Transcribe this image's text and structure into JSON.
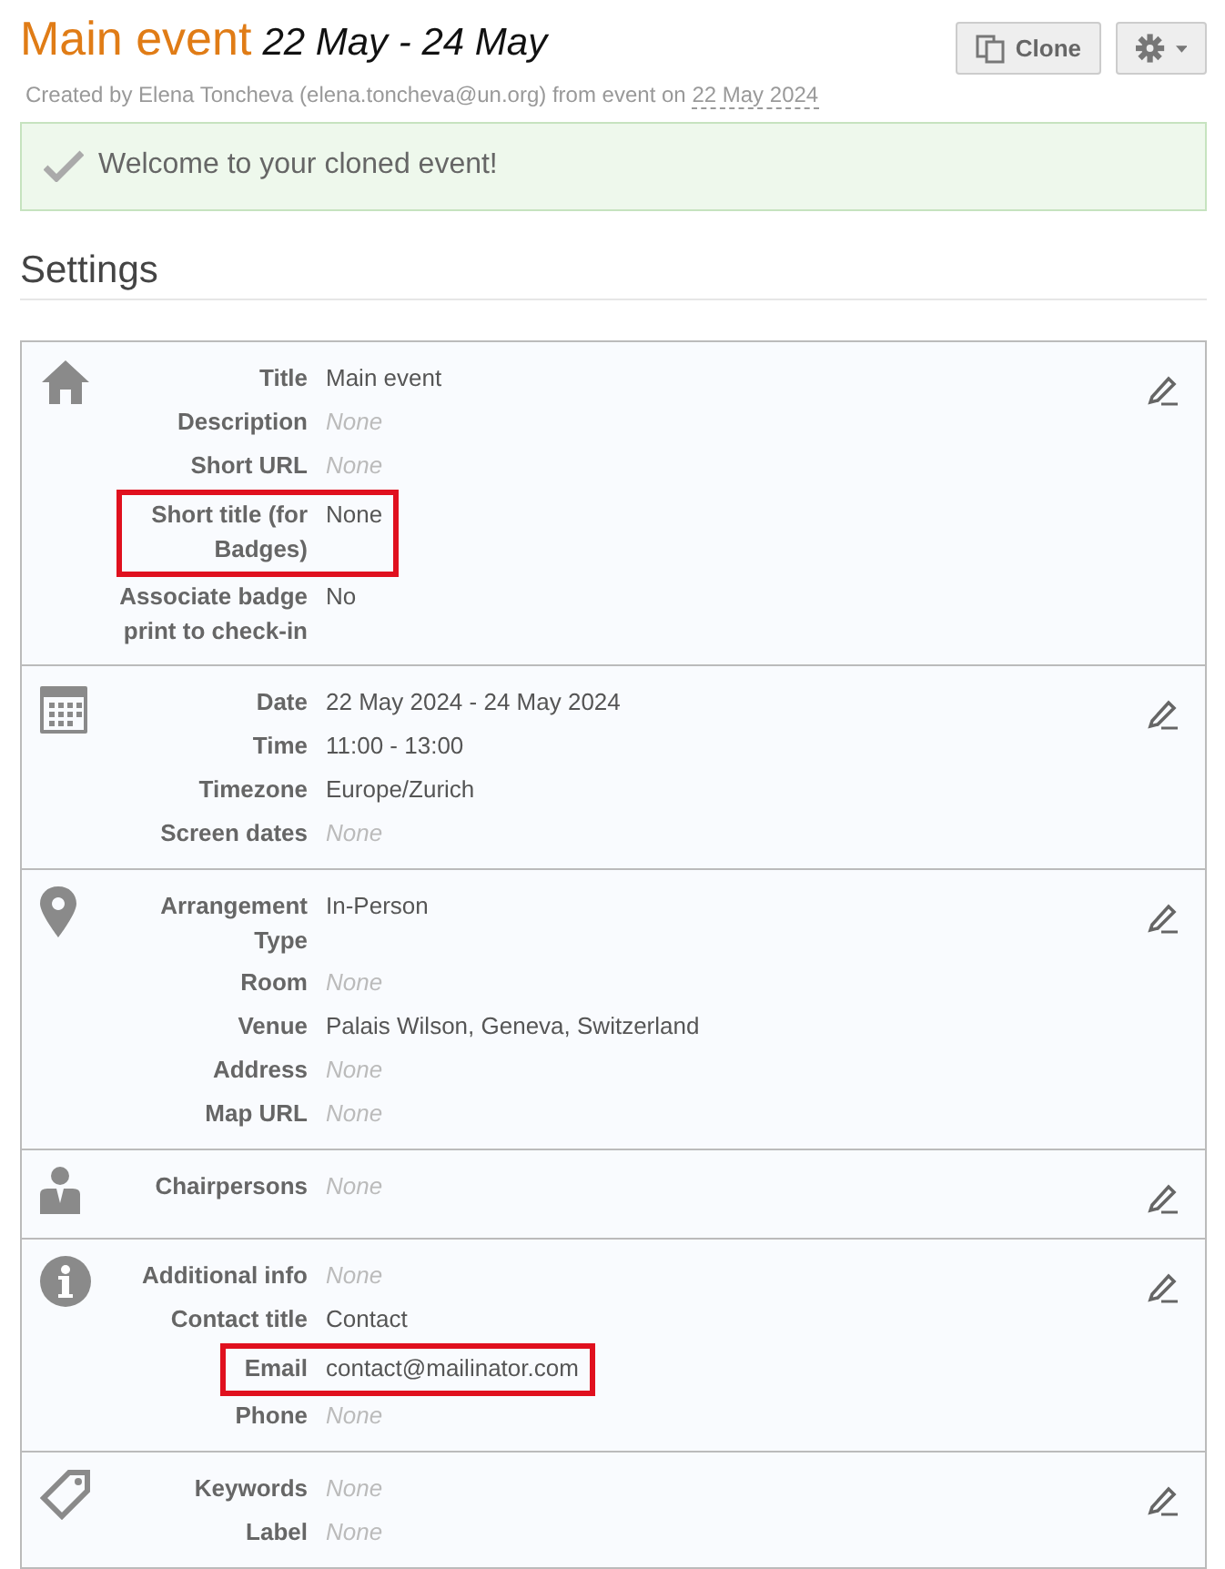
{
  "header": {
    "title": "Main event",
    "dates": "22 May - 24 May",
    "created_text": "Created by Elena Toncheva (elena.toncheva@un.org) from event on",
    "created_date": "22 May 2024"
  },
  "buttons": [
    {
      "kind": "clone",
      "label": "Clone"
    },
    {
      "kind": "settings"
    }
  ],
  "alert": {
    "text": "Welcome to your cloned event!"
  },
  "settings_heading": "Settings",
  "sections": [
    {
      "kind": "home",
      "fields": [
        {
          "label": "Title",
          "value": "Main event",
          "empty": false,
          "highlighted": false
        },
        {
          "label": "Description",
          "value": "None",
          "empty": true,
          "highlighted": false
        },
        {
          "label": "Short URL",
          "value": "None",
          "empty": true,
          "highlighted": false
        },
        {
          "label": "Short title (for Badges)",
          "value": "None",
          "empty": false,
          "highlighted": true
        },
        {
          "label": "Associate badge print to check-in",
          "value": "No",
          "empty": false,
          "highlighted": false
        }
      ]
    },
    {
      "kind": "calendar",
      "fields": [
        {
          "label": "Date",
          "value": "22 May 2024 - 24 May 2024",
          "empty": false,
          "highlighted": false
        },
        {
          "label": "Time",
          "value": "11:00 - 13:00",
          "empty": false,
          "highlighted": false
        },
        {
          "label": "Timezone",
          "value": "Europe/Zurich",
          "empty": false,
          "highlighted": false
        },
        {
          "label": "Screen dates",
          "value": "None",
          "empty": true,
          "highlighted": false
        }
      ]
    },
    {
      "kind": "pin",
      "fields": [
        {
          "label": "Arrangement Type",
          "value": "In-Person",
          "empty": false,
          "highlighted": false
        },
        {
          "label": "Room",
          "value": "None",
          "empty": true,
          "highlighted": false
        },
        {
          "label": "Venue",
          "value": "Palais Wilson, Geneva, Switzerland",
          "empty": false,
          "highlighted": false
        },
        {
          "label": "Address",
          "value": "None",
          "empty": true,
          "highlighted": false
        },
        {
          "label": "Map URL",
          "value": "None",
          "empty": true,
          "highlighted": false
        }
      ]
    },
    {
      "kind": "person",
      "fields": [
        {
          "label": "Chairpersons",
          "value": "None",
          "empty": true,
          "highlighted": false
        }
      ]
    },
    {
      "kind": "info",
      "fields": [
        {
          "label": "Additional info",
          "value": "None",
          "empty": true,
          "highlighted": false
        },
        {
          "label": "Contact title",
          "value": "Contact",
          "empty": false,
          "highlighted": false
        },
        {
          "label": "Email",
          "value": "contact@mailinator.com",
          "empty": false,
          "highlighted": true
        },
        {
          "label": "Phone",
          "value": "None",
          "empty": true,
          "highlighted": false
        }
      ]
    },
    {
      "kind": "tag",
      "fields": [
        {
          "label": "Keywords",
          "value": "None",
          "empty": true,
          "highlighted": false
        },
        {
          "label": "Label",
          "value": "None",
          "empty": true,
          "highlighted": false
        }
      ]
    }
  ]
}
